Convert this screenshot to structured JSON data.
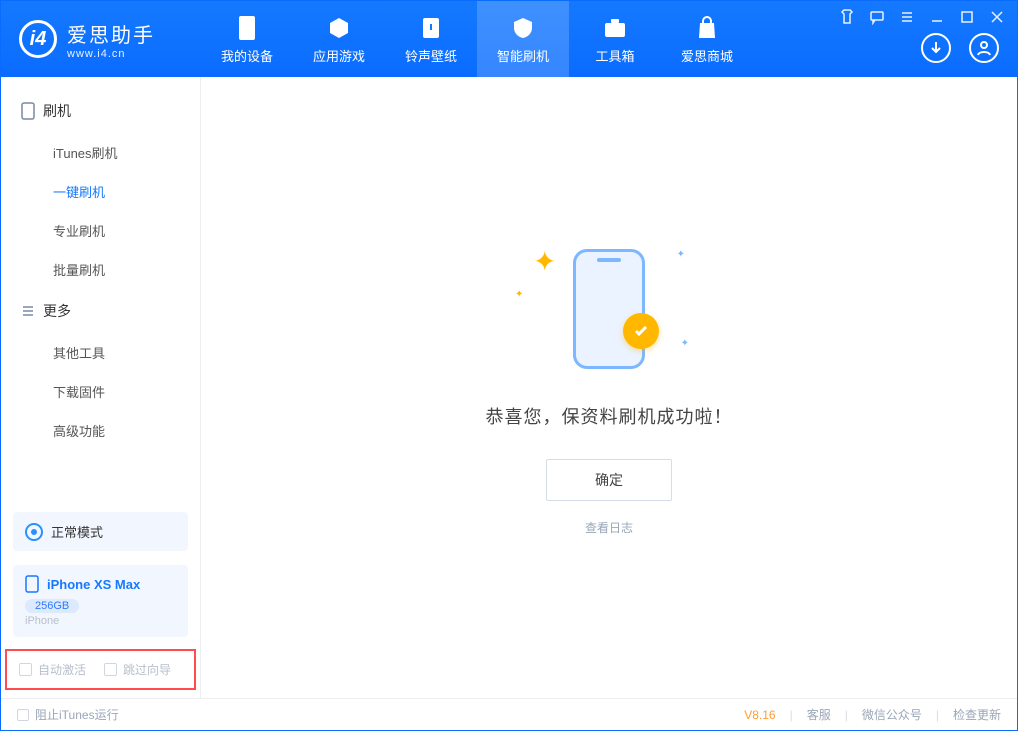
{
  "logo": {
    "title": "爱思助手",
    "subtitle": "www.i4.cn"
  },
  "nav": {
    "items": [
      {
        "label": "我的设备"
      },
      {
        "label": "应用游戏"
      },
      {
        "label": "铃声壁纸"
      },
      {
        "label": "智能刷机"
      },
      {
        "label": "工具箱"
      },
      {
        "label": "爱思商城"
      }
    ]
  },
  "sidebar": {
    "group1": "刷机",
    "items1": [
      {
        "label": "iTunes刷机"
      },
      {
        "label": "一键刷机"
      },
      {
        "label": "专业刷机"
      },
      {
        "label": "批量刷机"
      }
    ],
    "group2": "更多",
    "items2": [
      {
        "label": "其他工具"
      },
      {
        "label": "下载固件"
      },
      {
        "label": "高级功能"
      }
    ],
    "mode": "正常模式",
    "device": {
      "name": "iPhone XS Max",
      "storage": "256GB",
      "type": "iPhone"
    },
    "checks": {
      "auto_activate": "自动激活",
      "skip_guide": "跳过向导"
    }
  },
  "main": {
    "success_text": "恭喜您，保资料刷机成功啦！",
    "ok_label": "确定",
    "log_label": "查看日志"
  },
  "status": {
    "block_itunes": "阻止iTunes运行",
    "version": "V8.16",
    "support": "客服",
    "wechat": "微信公众号",
    "update": "检查更新"
  }
}
